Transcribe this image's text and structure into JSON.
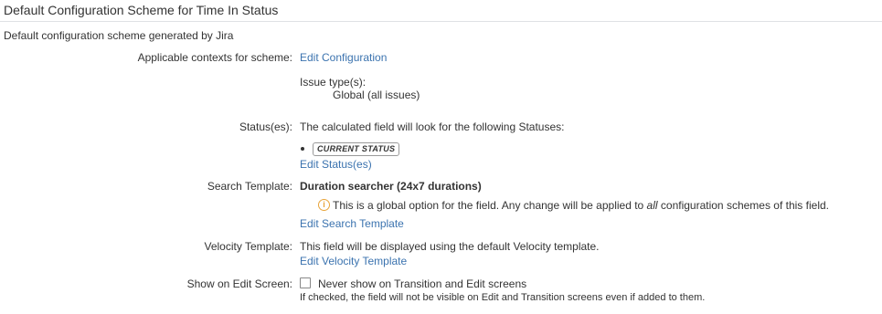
{
  "scheme": {
    "title": "Default Configuration Scheme for Time In Status",
    "description": "Default configuration scheme generated by Jira"
  },
  "contexts": {
    "label": "Applicable contexts for scheme:",
    "edit_link": "Edit Configuration",
    "issue_types_label": "Issue type(s):",
    "issue_types_value": "Global (all issues)"
  },
  "statuses": {
    "label": "Status(es):",
    "intro": "The calculated field will look for the following Statuses:",
    "items": [
      "CURRENT STATUS"
    ],
    "edit_link": "Edit Status(es)"
  },
  "search_template": {
    "label": "Search Template:",
    "value": "Duration searcher (24x7 durations)",
    "info_before": "This is a global option for the field. Any change will be applied to ",
    "info_emphasis": "all",
    "info_after": " configuration schemes of this field.",
    "edit_link": "Edit Search Template"
  },
  "velocity_template": {
    "label": "Velocity Template:",
    "text": "This field will be displayed using the default Velocity template.",
    "edit_link": "Edit Velocity Template"
  },
  "edit_screen": {
    "label": "Show on Edit Screen:",
    "checkbox_label": "Never show on Transition and Edit screens",
    "checked": false,
    "help": "If checked, the field will not be visible on Edit and Transition screens even if added to them."
  }
}
